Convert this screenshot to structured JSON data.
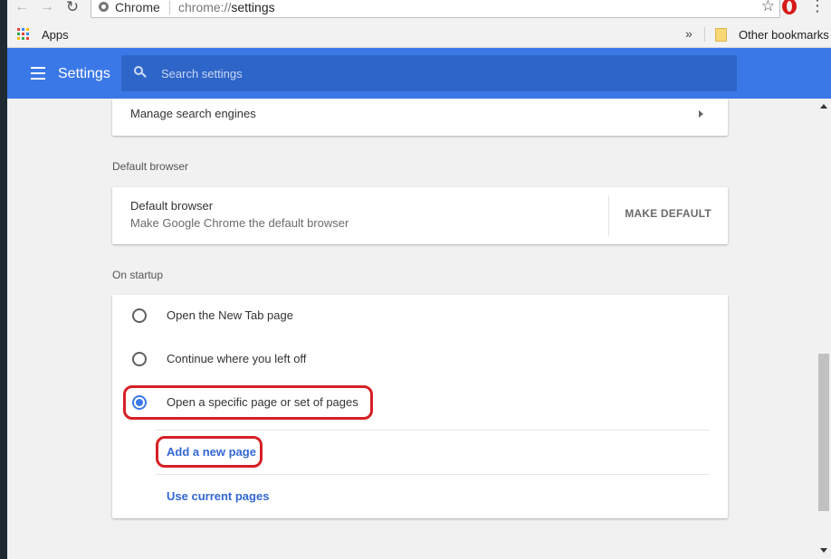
{
  "browser": {
    "chip_label": "Chrome",
    "url_scheme": "chrome://",
    "url_path": "settings"
  },
  "bookmarks": {
    "apps_label": "Apps",
    "overflow_label": "»",
    "other_label": "Other bookmarks"
  },
  "header": {
    "title": "Settings",
    "search_placeholder": "Search settings"
  },
  "search_engine": {
    "manage_label": "Manage search engines"
  },
  "default_browser": {
    "section_title": "Default browser",
    "row_title": "Default browser",
    "row_subtitle": "Make Google Chrome the default browser",
    "button_label": "MAKE DEFAULT"
  },
  "startup": {
    "section_title": "On startup",
    "options": [
      {
        "label": "Open the New Tab page",
        "selected": false
      },
      {
        "label": "Continue where you left off",
        "selected": false
      },
      {
        "label": "Open a specific page or set of pages",
        "selected": true
      }
    ],
    "add_page_label": "Add a new page",
    "use_current_label": "Use current pages"
  },
  "colors": {
    "accent": "#3b78e7",
    "annotation": "#d61f26",
    "link": "#3367d6"
  }
}
